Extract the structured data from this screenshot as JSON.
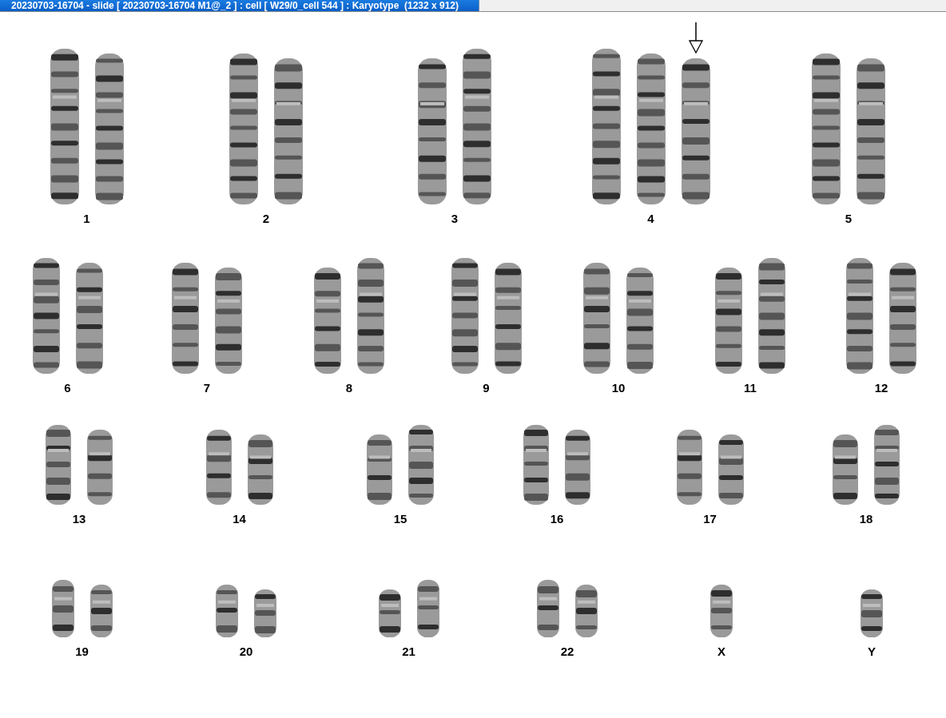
{
  "window": {
    "title": "20230703-16704 - slide [ 20230703-16704 M1@_2 ] : cell [ W29/0_cell 544 ] : Karyotype  (1232 x 912)"
  },
  "karyotype": {
    "rows": [
      {
        "groups": [
          {
            "label": "1",
            "homologs": [
              {
                "marked": false
              },
              {
                "marked": false
              }
            ]
          },
          {
            "label": "2",
            "homologs": [
              {
                "marked": false
              },
              {
                "marked": false
              }
            ]
          },
          {
            "label": "3",
            "homologs": [
              {
                "marked": false
              },
              {
                "marked": false
              }
            ]
          },
          {
            "label": "4",
            "homologs": [
              {
                "marked": false
              },
              {
                "marked": false
              },
              {
                "marked": true
              }
            ]
          },
          {
            "label": "5",
            "homologs": [
              {
                "marked": false
              },
              {
                "marked": false
              }
            ]
          }
        ]
      },
      {
        "groups": [
          {
            "label": "6",
            "homologs": [
              {
                "marked": false
              },
              {
                "marked": false
              }
            ]
          },
          {
            "label": "7",
            "homologs": [
              {
                "marked": false
              },
              {
                "marked": false
              }
            ]
          },
          {
            "label": "8",
            "homologs": [
              {
                "marked": false
              },
              {
                "marked": false
              }
            ]
          },
          {
            "label": "9",
            "homologs": [
              {
                "marked": false
              },
              {
                "marked": false
              }
            ]
          },
          {
            "label": "10",
            "homologs": [
              {
                "marked": false
              },
              {
                "marked": false
              }
            ]
          },
          {
            "label": "11",
            "homologs": [
              {
                "marked": false
              },
              {
                "marked": false
              }
            ]
          },
          {
            "label": "12",
            "homologs": [
              {
                "marked": false
              },
              {
                "marked": false
              }
            ]
          }
        ]
      },
      {
        "groups": [
          {
            "label": "13",
            "homologs": [
              {
                "marked": false
              },
              {
                "marked": false
              }
            ]
          },
          {
            "label": "14",
            "homologs": [
              {
                "marked": false
              },
              {
                "marked": false
              }
            ]
          },
          {
            "label": "15",
            "homologs": [
              {
                "marked": false
              },
              {
                "marked": false
              }
            ]
          },
          {
            "label": "16",
            "homologs": [
              {
                "marked": false
              },
              {
                "marked": false
              }
            ]
          },
          {
            "label": "17",
            "homologs": [
              {
                "marked": false
              },
              {
                "marked": false
              }
            ]
          },
          {
            "label": "18",
            "homologs": [
              {
                "marked": false
              },
              {
                "marked": false
              }
            ]
          }
        ]
      },
      {
        "groups": [
          {
            "label": "19",
            "homologs": [
              {
                "marked": false
              },
              {
                "marked": false
              }
            ]
          },
          {
            "label": "20",
            "homologs": [
              {
                "marked": false
              },
              {
                "marked": false
              }
            ]
          },
          {
            "label": "21",
            "homologs": [
              {
                "marked": false
              },
              {
                "marked": false
              }
            ]
          },
          {
            "label": "22",
            "homologs": [
              {
                "marked": false
              },
              {
                "marked": false
              }
            ]
          },
          {
            "label": "X",
            "homologs": [
              {
                "marked": false
              }
            ]
          },
          {
            "label": "Y",
            "homologs": [
              {
                "marked": false
              }
            ]
          }
        ]
      }
    ]
  }
}
